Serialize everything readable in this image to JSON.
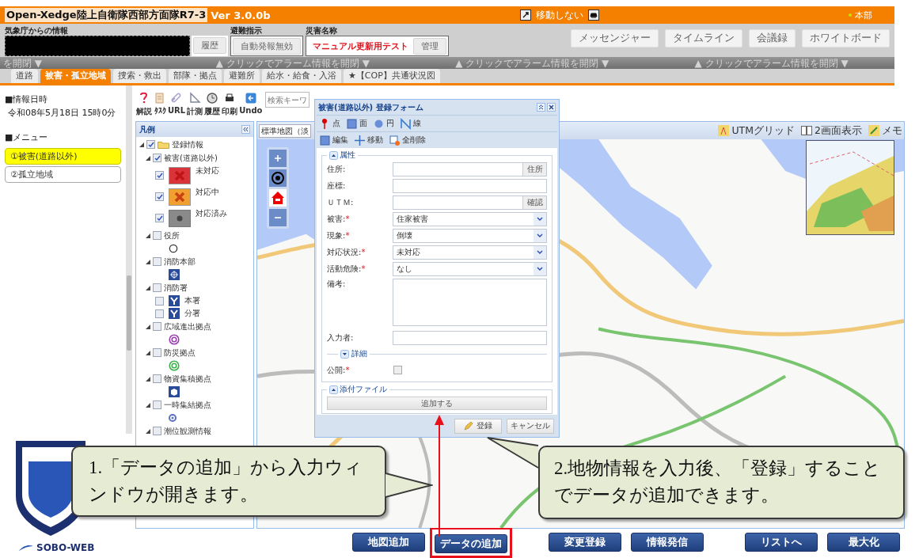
{
  "header": {
    "title": "Open-Xedge陸上自衛隊西部方面隊R7-3",
    "version": "Ver 3.0.0b",
    "move_mode": "移動しない",
    "location": "本部"
  },
  "info_bar": {
    "weather_label": "気象庁からの情報",
    "history_button": "履歴",
    "evac_label": "避難指示",
    "evac_button": "自動発報無効",
    "disaster_label": "災害名称",
    "disaster_name": "マニュアル更新用テスト",
    "manage_button": "管理",
    "tools": [
      "メッセンジャー",
      "タイムライン",
      "会議録",
      "ホワイトボード"
    ]
  },
  "alarm_bar": [
    "を開閉 ▼",
    "▲ クリックでアラーム情報を開閉 ▼",
    "▲ クリックでアラーム情報を開閉 ▼",
    "▲ クリックでアラーム情報を開閉 ▼"
  ],
  "tabs": [
    {
      "label": "道路",
      "selected": false
    },
    {
      "label": "被害・孤立地域",
      "selected": true
    },
    {
      "label": "捜索・救出",
      "selected": false
    },
    {
      "label": "部隊・拠点",
      "selected": false
    },
    {
      "label": "避難所",
      "selected": false
    },
    {
      "label": "給水・給食・入浴",
      "selected": false
    },
    {
      "label": "★【COP】共通状況図",
      "selected": false
    }
  ],
  "side": {
    "date_heading": "■情報日時",
    "date": "令和08年5月18日 15時0分",
    "menu_heading": "■メニュー",
    "logo_text": "SOBO-WEB"
  },
  "menu": [
    {
      "label": "①被害(道路以外)",
      "selected": true
    },
    {
      "label": "②孤立地域",
      "selected": false
    }
  ],
  "toolbar": [
    "解説",
    "ﾀｽｸ",
    "URL",
    "計測",
    "履歴",
    "印刷",
    "Undo"
  ],
  "search": {
    "placeholder": "検索キーワ"
  },
  "legend": {
    "title": "凡例",
    "items": [
      {
        "kind": "folder",
        "label": "登録情報",
        "checked": true,
        "expanded": true,
        "children": [
          {
            "kind": "group",
            "label": "被害(道路以外)",
            "checked": true,
            "expanded": true,
            "children": [
              {
                "kind": "x-mark",
                "color": "#d9343a",
                "checked": true,
                "label": "未対応"
              },
              {
                "kind": "x-mark",
                "color": "#f0a030",
                "checked": true,
                "label": "対応中"
              },
              {
                "kind": "dot",
                "color": "#8a8a8a",
                "checked": true,
                "label": "対応済み"
              }
            ]
          },
          {
            "kind": "group",
            "label": "役所",
            "checked": false,
            "expanded": true,
            "children": [
              {
                "kind": "ring",
                "color": "#333333"
              }
            ]
          },
          {
            "kind": "group",
            "label": "消防本部",
            "checked": false,
            "expanded": true,
            "children": [
              {
                "kind": "emblem",
                "color": "#2a4a9a"
              }
            ]
          },
          {
            "kind": "group",
            "label": "消防署",
            "checked": false,
            "expanded": true,
            "children": [
              {
                "kind": "fork",
                "color": "#2a4a9a",
                "checked": false,
                "label": "本署"
              },
              {
                "kind": "fork",
                "color": "#2a4a9a",
                "checked": false,
                "label": "分署"
              }
            ]
          },
          {
            "kind": "group",
            "label": "広域進出拠点",
            "checked": false,
            "expanded": true,
            "children": [
              {
                "kind": "double-ring",
                "color": "#9b3fb0"
              }
            ]
          },
          {
            "kind": "group",
            "label": "防災拠点",
            "checked": false,
            "expanded": true,
            "children": [
              {
                "kind": "double-ring",
                "color": "#3bb24a"
              }
            ]
          },
          {
            "kind": "group",
            "label": "物資集積拠点",
            "checked": false,
            "expanded": true,
            "children": [
              {
                "kind": "crate",
                "color": "#2a4a9a"
              }
            ]
          },
          {
            "kind": "group",
            "label": "一時集結拠点",
            "checked": false,
            "expanded": true,
            "children": [
              {
                "kind": "small-ring",
                "color": "#5a6fc0"
              }
            ]
          },
          {
            "kind": "group",
            "label": "潮位観測情報",
            "checked": false,
            "expanded": true
          }
        ]
      }
    ]
  },
  "map": {
    "layer": "標準地図（淡",
    "tools": [
      "UTMグリッド",
      "2画面表示",
      "メモ"
    ]
  },
  "form": {
    "title": "被害(道路以外) 登録フォーム",
    "draw_tools": [
      "点",
      "面",
      "円",
      "線"
    ],
    "edit_tools": [
      "編集",
      "移動",
      "全削除"
    ],
    "sections": [
      {
        "title": "属性",
        "expanded": true,
        "fields": [
          {
            "kind": "text",
            "label": "住所:",
            "button": "住所"
          },
          {
            "kind": "text",
            "label": "座標:"
          },
          {
            "kind": "text",
            "label": "ＵＴＭ:",
            "button": "確認"
          },
          {
            "kind": "select",
            "label": "被害:",
            "mark": "*",
            "value": "住家被害"
          },
          {
            "kind": "select",
            "label": "現象:",
            "mark": "*",
            "value": "倒壊"
          },
          {
            "kind": "select",
            "label": "対応状況:",
            "mark": "*",
            "value": "未対応"
          },
          {
            "kind": "select",
            "label": "活動危険:",
            "mark": "*",
            "value": "なし"
          },
          {
            "kind": "textarea",
            "label": "備考:"
          },
          {
            "kind": "text",
            "label": "入力者:"
          },
          {
            "kind": "subsection",
            "label": "詳細",
            "expanded": false
          },
          {
            "kind": "checkbox",
            "label": "公開:",
            "mark": "*",
            "checked": false
          }
        ]
      },
      {
        "title": "添付ファイル",
        "expanded": true,
        "button": "追加する"
      }
    ],
    "submit": "登録",
    "cancel": "キャンセル"
  },
  "callouts": [
    {
      "text": "1.「データの追加」から入力ウィンドウが開きます。"
    },
    {
      "text": "2.地物情報を入力後、「登録」することでデータが追加できます。"
    }
  ],
  "actions": [
    {
      "label": "地図追加",
      "highlighted": false
    },
    {
      "label": "データの追加",
      "highlighted": true
    },
    {
      "label": "変更登録",
      "highlighted": false
    },
    {
      "label": "情報発信",
      "highlighted": false
    },
    {
      "label": "リストへ",
      "highlighted": false
    },
    {
      "label": "最大化",
      "highlighted": false
    }
  ]
}
